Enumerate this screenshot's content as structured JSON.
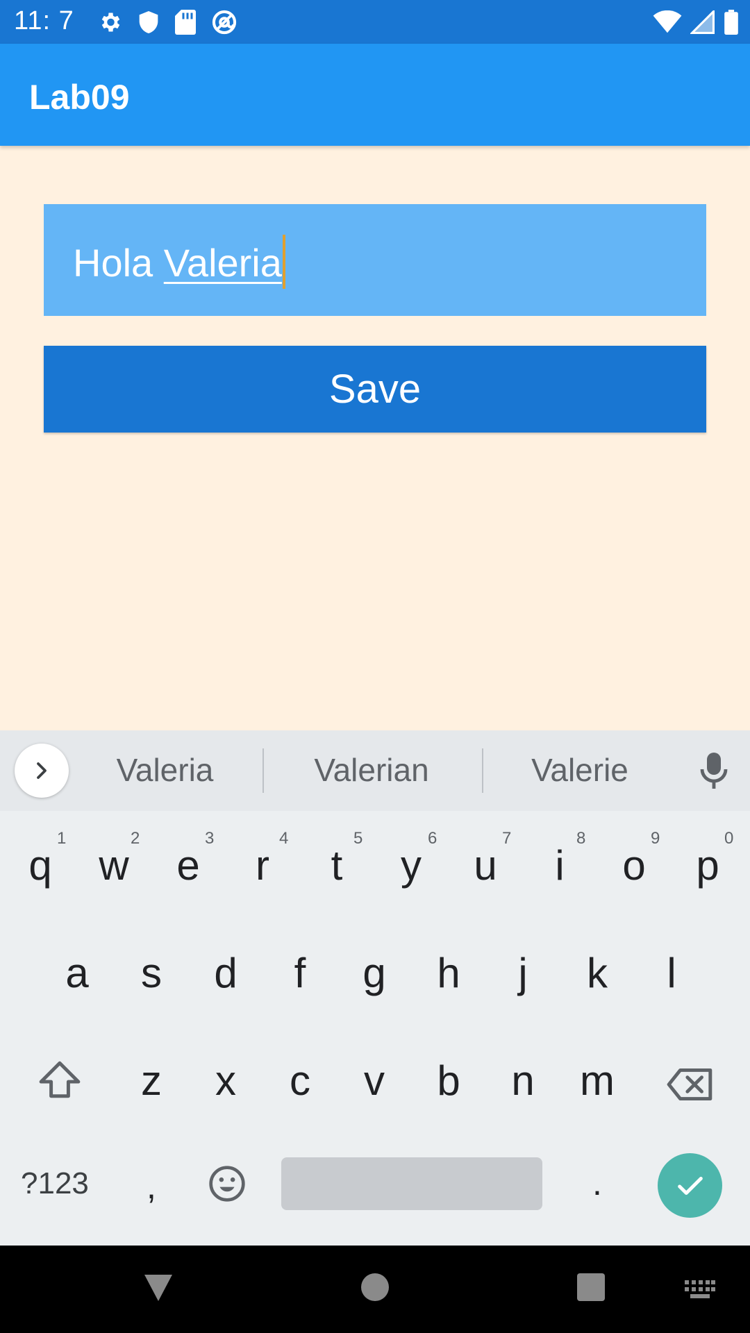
{
  "status_bar": {
    "time": "11: 7",
    "left_icons": [
      "gear-icon",
      "shield-icon",
      "sd-card-icon",
      "at-sign-icon"
    ],
    "right_icons": [
      "wifi-icon",
      "signal-icon",
      "battery-icon"
    ]
  },
  "app_bar": {
    "title": "Lab09"
  },
  "entry": {
    "text_plain": "Hola ",
    "text_underlined": "Valeria"
  },
  "save_button": {
    "label": "Save"
  },
  "keyboard": {
    "suggestions": [
      "Valeria",
      "Valerian",
      "Valerie"
    ],
    "row1": [
      {
        "key": "q",
        "hint": "1"
      },
      {
        "key": "w",
        "hint": "2"
      },
      {
        "key": "e",
        "hint": "3"
      },
      {
        "key": "r",
        "hint": "4"
      },
      {
        "key": "t",
        "hint": "5"
      },
      {
        "key": "y",
        "hint": "6"
      },
      {
        "key": "u",
        "hint": "7"
      },
      {
        "key": "i",
        "hint": "8"
      },
      {
        "key": "o",
        "hint": "9"
      },
      {
        "key": "p",
        "hint": "0"
      }
    ],
    "row2": [
      "a",
      "s",
      "d",
      "f",
      "g",
      "h",
      "j",
      "k",
      "l"
    ],
    "row3": [
      "z",
      "x",
      "c",
      "v",
      "b",
      "n",
      "m"
    ],
    "symbols_label": "?123",
    "comma": ",",
    "period": "."
  },
  "colors": {
    "status_bar": "#1976D2",
    "app_bar": "#2196F3",
    "background": "#FFF1E0",
    "entry": "#64B5F6",
    "button": "#1976D2",
    "enter_key": "#4DB6AC"
  }
}
